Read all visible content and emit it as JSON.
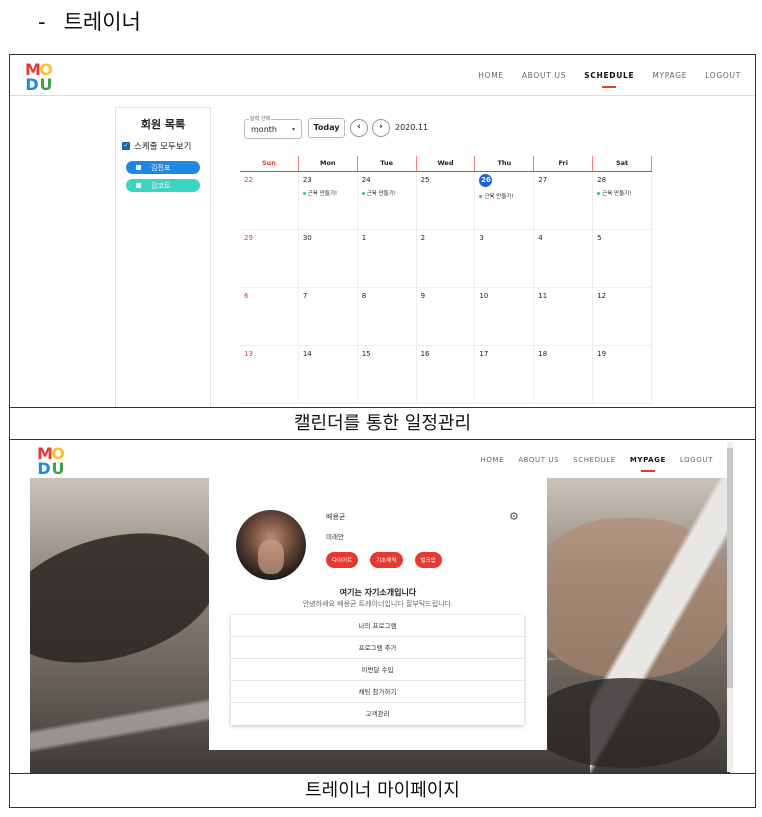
{
  "doc": {
    "dash": "-",
    "heading": "트레이너"
  },
  "logo": {
    "m": "M",
    "o": "O",
    "d": "D",
    "u": "U"
  },
  "colors": {
    "accent_red": "#e53935",
    "today_blue": "#1e63d6",
    "chip_blue": "#1e88e5",
    "chip_teal": "#3ad6c0",
    "event_dot": "#2ebd8f"
  },
  "schedule_view": {
    "nav": [
      "HOME",
      "ABOUT US",
      "SCHEDULE",
      "MYPAGE",
      "LOGOUT"
    ],
    "nav_active": "SCHEDULE",
    "member_list": {
      "title": "회원 목록",
      "show_all_label": "스케줄 모두보기",
      "members": [
        {
          "name": "김진표",
          "color": "#1e88e5"
        },
        {
          "name": "김코트",
          "color": "#3ad6c0"
        }
      ]
    },
    "controls": {
      "select_label": "달력 선택",
      "select_value": "month",
      "caret": "▾",
      "today_label": "Today",
      "prev": "‹",
      "next": "›",
      "current_month": "2020.11"
    },
    "weekdays": [
      "Sun",
      "Mon",
      "Tue",
      "Wed",
      "Thu",
      "Fri",
      "Sat"
    ],
    "weeks": [
      [
        {
          "day": "22"
        },
        {
          "day": "23",
          "event": "근육 만들기!"
        },
        {
          "day": "24",
          "event": "근육 만들기!"
        },
        {
          "day": "25"
        },
        {
          "day": "26",
          "today": true,
          "event": "근육 만들기!"
        },
        {
          "day": "27"
        },
        {
          "day": "28",
          "event": "근육 만들기!"
        }
      ],
      [
        {
          "day": "29"
        },
        {
          "day": "30"
        },
        {
          "day": "1"
        },
        {
          "day": "2"
        },
        {
          "day": "3"
        },
        {
          "day": "4"
        },
        {
          "day": "5"
        }
      ],
      [
        {
          "day": "6"
        },
        {
          "day": "7"
        },
        {
          "day": "8"
        },
        {
          "day": "9"
        },
        {
          "day": "10"
        },
        {
          "day": "11"
        },
        {
          "day": "12"
        }
      ],
      [
        {
          "day": "13"
        },
        {
          "day": "14"
        },
        {
          "day": "15"
        },
        {
          "day": "16"
        },
        {
          "day": "17"
        },
        {
          "day": "18"
        },
        {
          "day": "19"
        }
      ]
    ],
    "caption": "캘린더를 통한 일정관리"
  },
  "mypage_view": {
    "nav": [
      "HOME",
      "ABOUT US",
      "SCHEDULE",
      "MYPAGE",
      "LOGOUT"
    ],
    "nav_active": "MYPAGE",
    "profile": {
      "name": "배용균",
      "subtitle": "미래안",
      "gear_icon": "⚙",
      "tags": [
        "다이어트",
        "기초체력",
        "벌크업"
      ],
      "intro_title": "여기는 자기소개입니다",
      "intro_text": "안녕하세요 배용균 트레이너입니다 잘부탁드립니다."
    },
    "menu": [
      "나의 프로그램",
      "프로그램 추가",
      "이번달 수입",
      "채팅 참가하기",
      "고객관리"
    ],
    "caption": "트레이너 마이페이지"
  }
}
